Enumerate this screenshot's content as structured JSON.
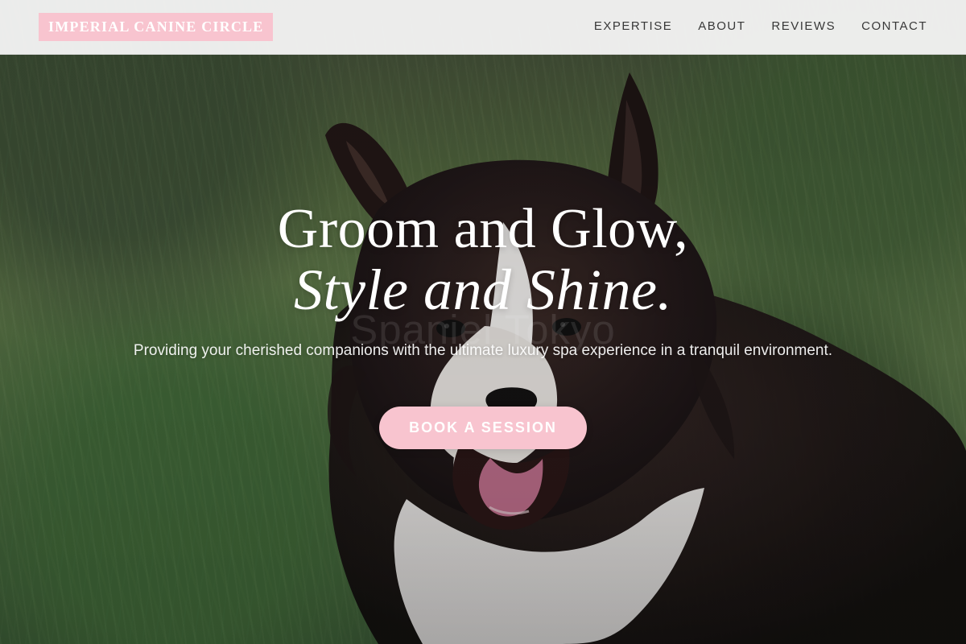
{
  "header": {
    "brand": "IMPERIAL CANINE CIRCLE",
    "nav": [
      "EXPERTISE",
      "ABOUT",
      "REVIEWS",
      "CONTACT"
    ]
  },
  "hero": {
    "title_line_1": "Groom and Glow,",
    "title_line_2": "Style and Shine.",
    "subtitle": "Providing your cherished companions with the ultimate luxury spa experience in a tranquil environment.",
    "cta_label": "BOOK A SESSION",
    "watermark_text": "Spaniel Tokyo"
  },
  "colors": {
    "brand_pink": "#f8c4cf",
    "header_bg": "#f5f5f5",
    "text_dark": "#383838",
    "text_light": "#ffffff"
  }
}
